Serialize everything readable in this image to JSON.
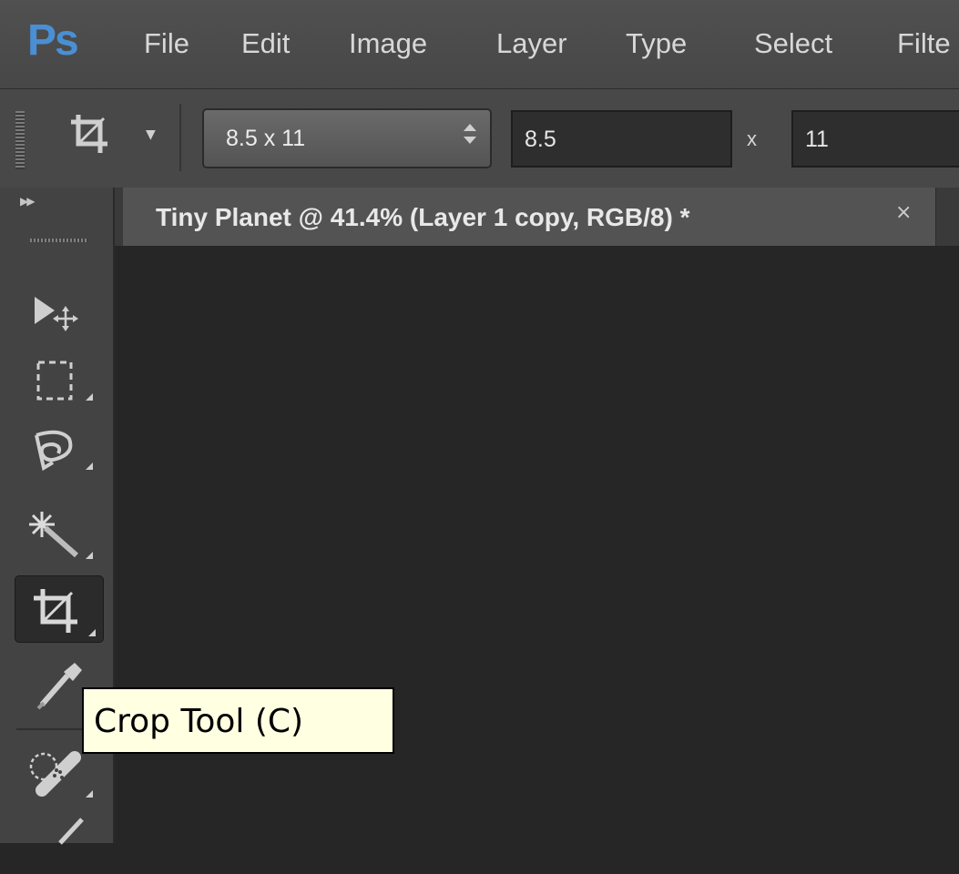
{
  "app": {
    "logo": "Ps"
  },
  "menu": [
    "File",
    "Edit",
    "Image",
    "Layer",
    "Type",
    "Select",
    "Filte"
  ],
  "options_bar": {
    "tool_icon": "crop-icon",
    "preset": "8.5 x 11",
    "width": "8.5",
    "times": "x",
    "height": "11"
  },
  "document_tab": {
    "title": "Tiny Planet @ 41.4% (Layer 1 copy, RGB/8) *",
    "close": "×"
  },
  "toolbar": {
    "tools": [
      "move-tool",
      "rectangular-marquee-tool",
      "lasso-tool",
      "magic-wand-tool",
      "crop-tool",
      "eyedropper-tool",
      "spot-healing-brush-tool",
      "brush-tool"
    ],
    "active_tool": "crop-tool"
  },
  "tooltip": {
    "text": "Crop Tool (C)"
  },
  "colors": {
    "canvas_bg": "#262626",
    "panel_bg": "#434343",
    "logo": "#4a8fd4",
    "tooltip_bg": "#ffffe1"
  }
}
